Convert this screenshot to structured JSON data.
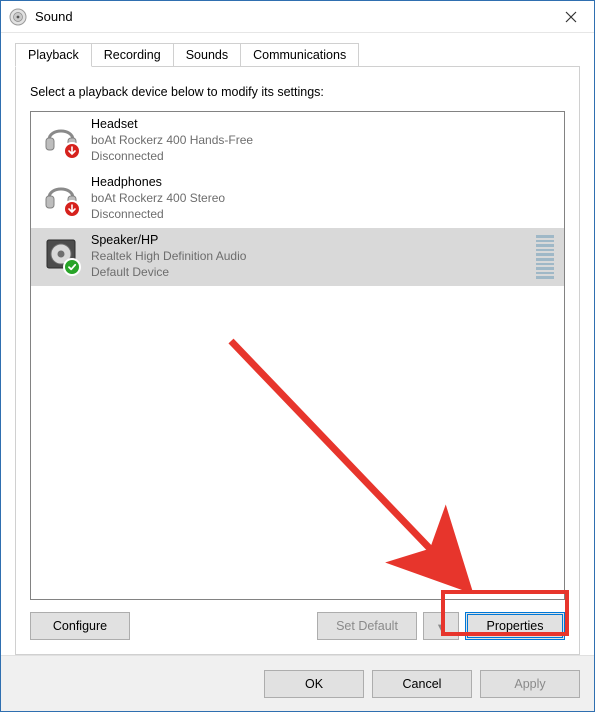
{
  "title": "Sound",
  "tabs": [
    {
      "label": "Playback",
      "active": true
    },
    {
      "label": "Recording",
      "active": false
    },
    {
      "label": "Sounds",
      "active": false
    },
    {
      "label": "Communications",
      "active": false
    }
  ],
  "instruction": "Select a playback device below to modify its settings:",
  "devices": [
    {
      "name": "Headset",
      "desc": "boAt Rockerz 400 Hands-Free",
      "status": "Disconnected",
      "type": "headset",
      "badge": "down",
      "selected": false,
      "meter": false
    },
    {
      "name": "Headphones",
      "desc": "boAt Rockerz 400 Stereo",
      "status": "Disconnected",
      "type": "headset",
      "badge": "down",
      "selected": false,
      "meter": false
    },
    {
      "name": "Speaker/HP",
      "desc": "Realtek High Definition Audio",
      "status": "Default Device",
      "type": "speaker",
      "badge": "check",
      "selected": true,
      "meter": true
    }
  ],
  "buttons": {
    "configure": "Configure",
    "setDefault": "Set Default",
    "setDefaultDrop": "▾",
    "properties": "Properties",
    "ok": "OK",
    "cancel": "Cancel",
    "apply": "Apply"
  }
}
